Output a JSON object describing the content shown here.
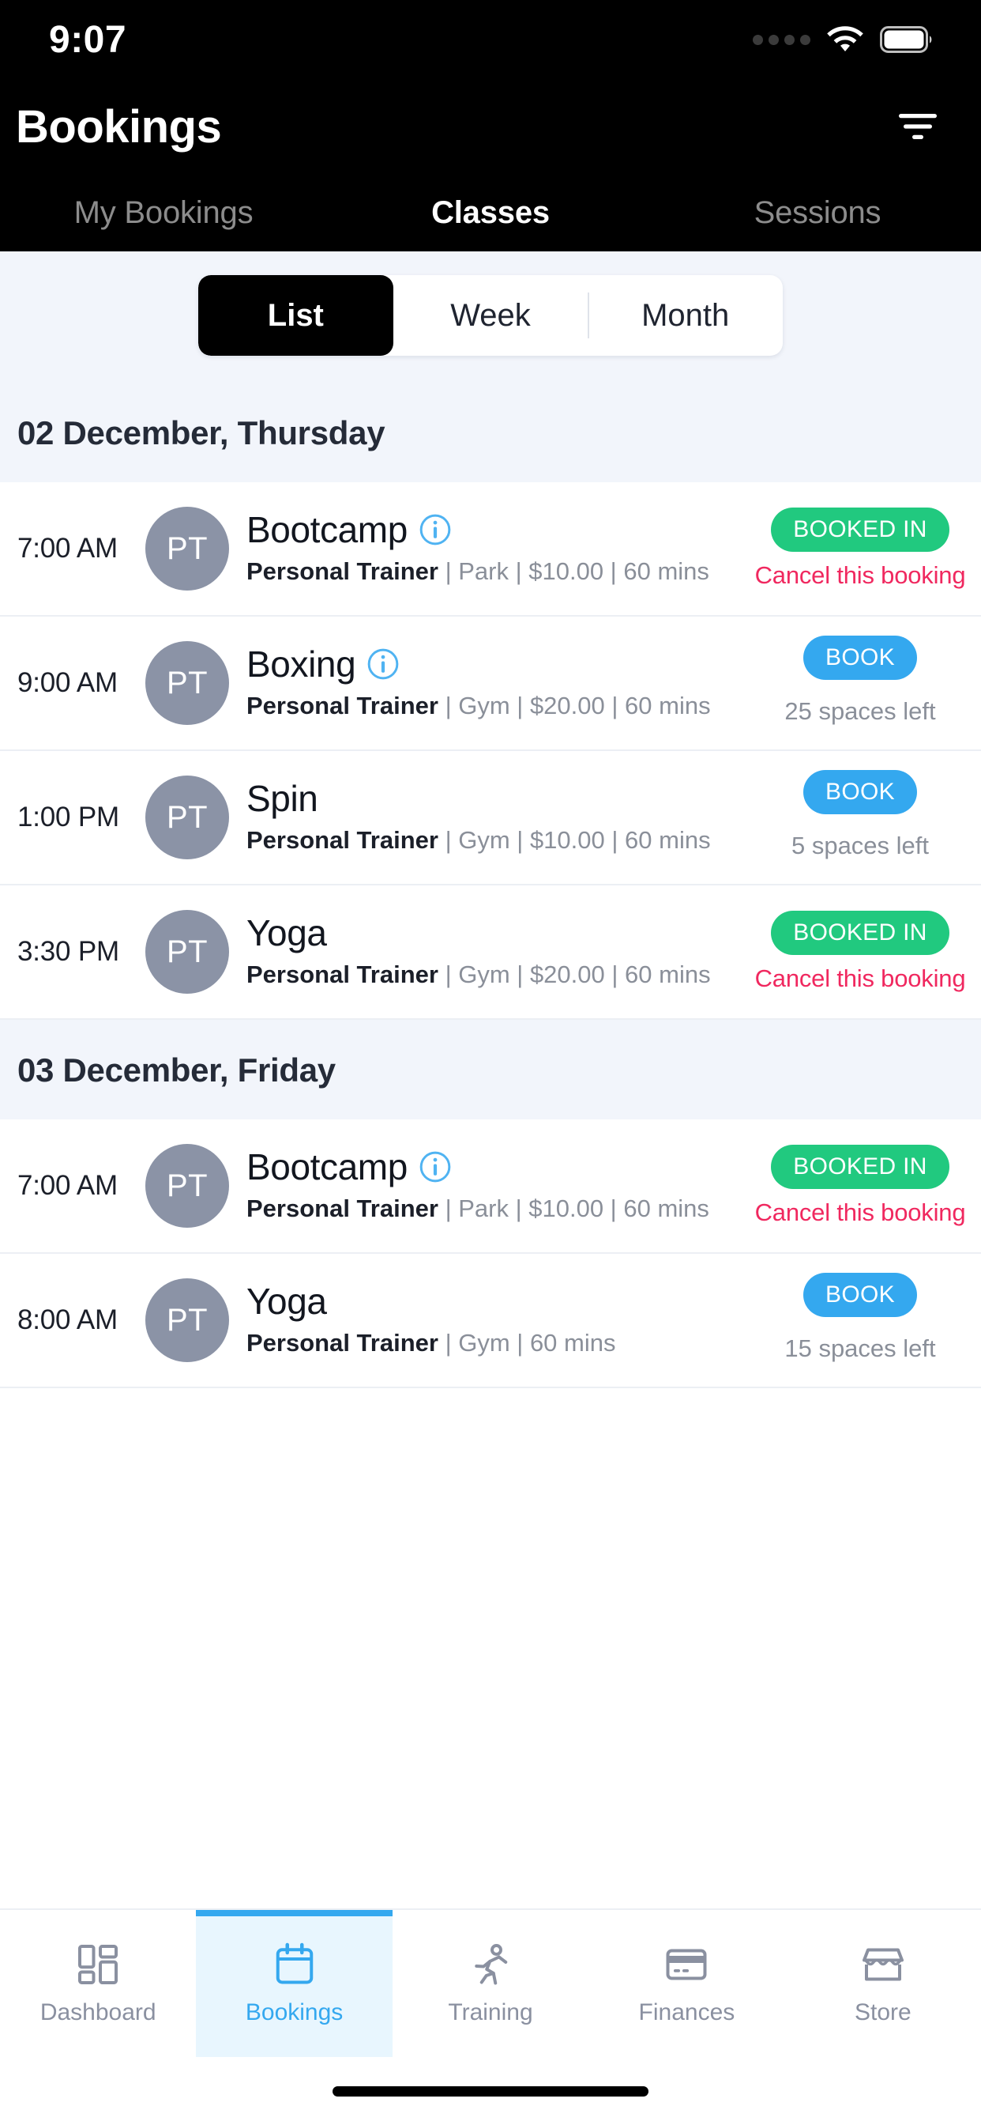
{
  "status_bar": {
    "time": "9:07",
    "signal_icon": "signal-dots-icon",
    "wifi_icon": "wifi-icon",
    "battery_icon": "battery-full-icon"
  },
  "app_bar": {
    "title": "Bookings",
    "filter_icon": "filter-icon"
  },
  "top_tabs": [
    {
      "label": "My Bookings",
      "active": false
    },
    {
      "label": "Classes",
      "active": true
    },
    {
      "label": "Sessions",
      "active": false
    }
  ],
  "view_toggle": [
    {
      "label": "List",
      "active": true
    },
    {
      "label": "Week",
      "active": false
    },
    {
      "label": "Month",
      "active": false
    }
  ],
  "colors": {
    "booked_green": "#21c97f",
    "book_blue": "#34a8ef",
    "cancel_pink": "#f0285f",
    "avatar_gray": "#8b93a6",
    "section_bg": "#f2f5fb",
    "active_nav": "#34a8ef"
  },
  "sections": [
    {
      "date": "02 December, Thursday",
      "rows": [
        {
          "time": "7:00 AM",
          "avatar": "PT",
          "title": "Bootcamp",
          "has_info": true,
          "trainer": "Personal Trainer",
          "details": " | Park | $10.00 | 60 mins",
          "status_label": "BOOKED IN",
          "status_type": "booked",
          "cancel_label": "Cancel this booking",
          "spaces": null
        },
        {
          "time": "9:00 AM",
          "avatar": "PT",
          "title": "Boxing",
          "has_info": true,
          "trainer": "Personal Trainer",
          "details": " | Gym | $20.00 | 60 mins",
          "status_label": "BOOK",
          "status_type": "book",
          "cancel_label": null,
          "spaces": "25 spaces left"
        },
        {
          "time": "1:00 PM",
          "avatar": "PT",
          "title": "Spin",
          "has_info": false,
          "trainer": "Personal Trainer",
          "details": " | Gym | $10.00 | 60 mins",
          "status_label": "BOOK",
          "status_type": "book",
          "cancel_label": null,
          "spaces": "5 spaces left"
        },
        {
          "time": "3:30 PM",
          "avatar": "PT",
          "title": "Yoga",
          "has_info": false,
          "trainer": "Personal Trainer",
          "details": " | Gym | $20.00 | 60 mins",
          "status_label": "BOOKED IN",
          "status_type": "booked",
          "cancel_label": "Cancel this booking",
          "spaces": null
        }
      ]
    },
    {
      "date": "03 December, Friday",
      "rows": [
        {
          "time": "7:00 AM",
          "avatar": "PT",
          "title": "Bootcamp",
          "has_info": true,
          "trainer": "Personal Trainer",
          "details": " | Park | $10.00 | 60 mins",
          "status_label": "BOOKED IN",
          "status_type": "booked",
          "cancel_label": "Cancel this booking",
          "spaces": null
        },
        {
          "time": "8:00 AM",
          "avatar": "PT",
          "title": "Yoga",
          "has_info": false,
          "trainer": "Personal Trainer",
          "details": " | Gym | 60 mins",
          "status_label": "BOOK",
          "status_type": "book",
          "cancel_label": null,
          "spaces": "15 spaces left"
        }
      ]
    }
  ],
  "bottom_nav": [
    {
      "label": "Dashboard",
      "icon": "dashboard-grid-icon",
      "active": false
    },
    {
      "label": "Bookings",
      "icon": "calendar-icon",
      "active": true
    },
    {
      "label": "Training",
      "icon": "running-person-icon",
      "active": false
    },
    {
      "label": "Finances",
      "icon": "credit-card-icon",
      "active": false
    },
    {
      "label": "Store",
      "icon": "store-awning-icon",
      "active": false
    }
  ]
}
